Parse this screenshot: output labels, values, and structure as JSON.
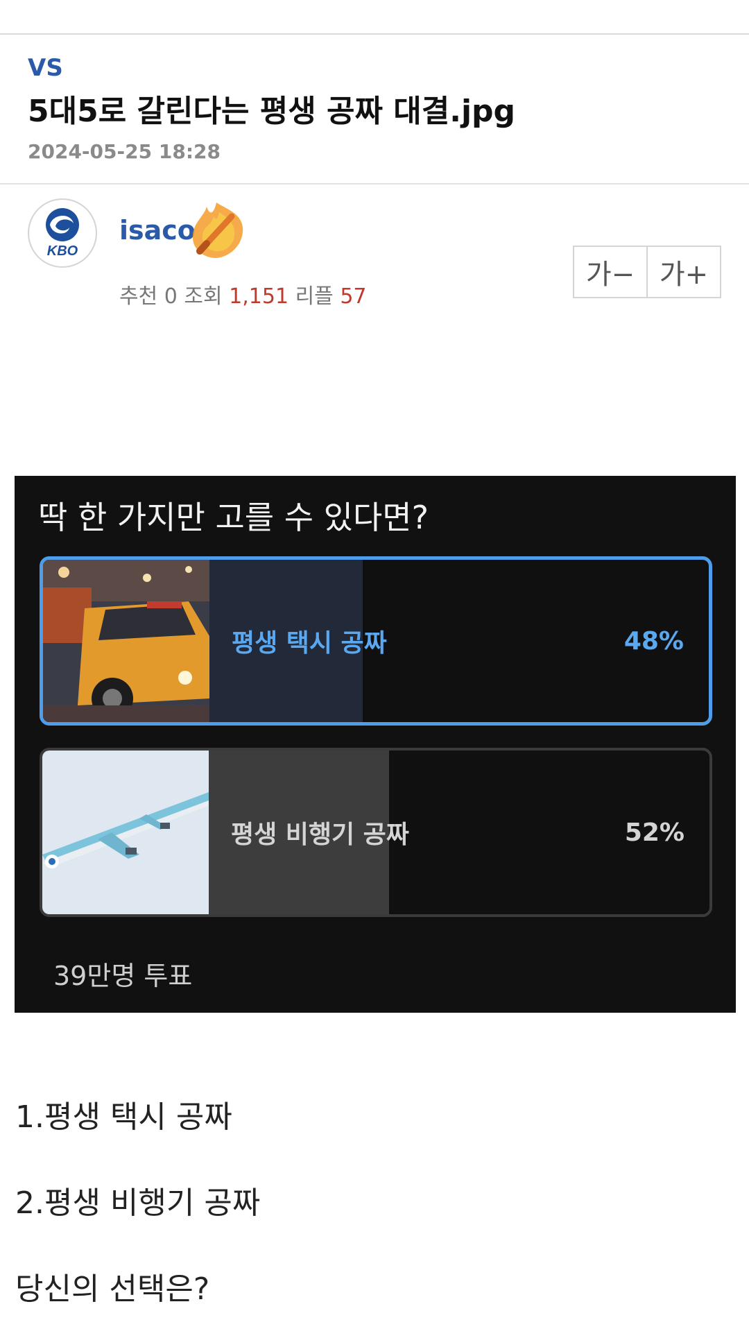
{
  "post": {
    "category": "VS",
    "title": "5대5로 갈린다는 평생 공짜 대결.jpg",
    "date": "2024-05-25 18:28"
  },
  "author": {
    "name": "isaco",
    "avatar_text": "KBO",
    "avatar_icon": "kbo-logo-icon",
    "badge_icon": "flaming-baseball-bat-icon"
  },
  "stats": {
    "recommend_label": "추천",
    "recommend": "0",
    "views_label": "조회",
    "views": "1,151",
    "replies_label": "리플",
    "replies": "57"
  },
  "font_controls": {
    "decrease": "가−",
    "increase": "가+"
  },
  "poll": {
    "question": "딱 한 가지만 고를 수 있다면?",
    "options": [
      {
        "label": "평생 택시 공짜",
        "percent": "48%",
        "fill": 0.48,
        "selected": true,
        "image_icon": "taxi-photo"
      },
      {
        "label": "평생 비행기 공짜",
        "percent": "52%",
        "fill": 0.52,
        "selected": false,
        "image_icon": "airplane-photo"
      }
    ],
    "votes": "39만명 투표",
    "colors": {
      "background": "#111111",
      "selected_border": "#4f9de8",
      "selected_text": "#5aa8f0"
    }
  },
  "body": {
    "lines": [
      "1.평생 택시 공짜",
      "2.평생 비행기 공짜",
      "당신의 선택은?"
    ]
  },
  "colors": {
    "accent": "#2a5aa8",
    "count_red": "#c0392b"
  }
}
